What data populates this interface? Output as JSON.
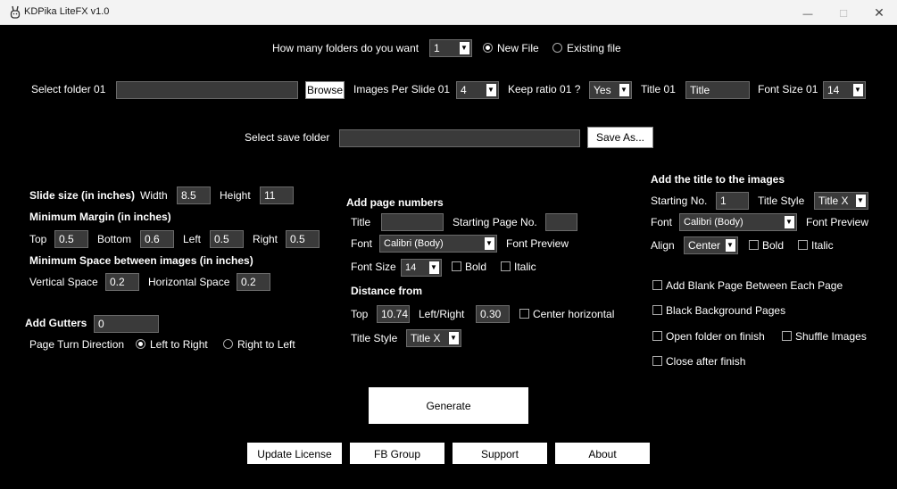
{
  "window": {
    "title": "KDPika LiteFX v1.0",
    "minimize_glyph": "—",
    "maximize_glyph": "☐",
    "close_glyph": "✕"
  },
  "top": {
    "folders_label": "How many folders do you want",
    "folders_value": "1",
    "new_file_label": "New File",
    "existing_file_label": "Existing file",
    "mode_selected": "New File"
  },
  "folder_row": {
    "select_label": "Select folder 01",
    "folder_value": "",
    "browse_label": "Browse",
    "images_per_slide_label": "Images Per Slide 01",
    "images_per_slide_value": "4",
    "keep_ratio_label": "Keep ratio 01 ?",
    "keep_ratio_value": "Yes",
    "title_label": "Title 01",
    "title_value": "Title",
    "font_size_label": "Font Size 01",
    "font_size_value": "14"
  },
  "save_row": {
    "select_label": "Select save folder",
    "folder_value": "",
    "save_as_label": "Save As..."
  },
  "slide": {
    "slide_size_label": "Slide size (in inches)",
    "width_label": "Width",
    "width_value": "8.5",
    "height_label": "Height",
    "height_value": "11",
    "min_margin_label": "Minimum Margin (in inches)",
    "top_label": "Top",
    "top_value": "0.5",
    "bottom_label": "Bottom",
    "bottom_value": "0.6",
    "left_label": "Left",
    "left_value": "0.5",
    "right_label": "Right",
    "right_value": "0.5",
    "min_space_label": "Minimum Space between images (in inches)",
    "vertical_label": "Vertical Space",
    "vertical_value": "0.2",
    "horizontal_label": "Horizontal Space",
    "horizontal_value": "0.2",
    "gutters_label": "Add Gutters",
    "gutters_value": "0",
    "page_turn_label": "Page Turn Direction",
    "ltr_label": "Left to Right",
    "rtl_label": "Right to Left"
  },
  "page_numbers": {
    "heading": "Add page numbers",
    "title_label": "Title",
    "title_value": "",
    "starting_label": "Starting Page No.",
    "starting_value": "",
    "font_label": "Font",
    "font_value": "Calibri (Body)",
    "font_preview_label": "Font Preview",
    "font_size_label": "Font Size",
    "font_size_value": "14",
    "bold_label": "Bold",
    "italic_label": "Italic",
    "distance_heading": "Distance from",
    "top_label": "Top",
    "top_value": "10.74",
    "lr_label": "Left/Right",
    "lr_value": "0.30",
    "center_label": "Center horizontal",
    "title_style_label": "Title Style",
    "title_style_value": "Title X"
  },
  "title_images": {
    "heading": "Add the title to the images",
    "starting_label": "Starting No.",
    "starting_value": "1",
    "title_style_label": "Title Style",
    "title_style_value": "Title X",
    "font_label": "Font",
    "font_value": "Calibri (Body)",
    "font_preview_label": "Font Preview",
    "align_label": "Align",
    "align_value": "Center",
    "bold_label": "Bold",
    "italic_label": "Italic"
  },
  "options": {
    "blank_page_label": "Add Blank Page Between Each Page",
    "black_bg_label": "Black Background Pages",
    "open_folder_label": "Open folder on finish",
    "shuffle_label": "Shuffle Images",
    "close_after_label": "Close after finish"
  },
  "actions": {
    "generate_label": "Generate",
    "update_license_label": "Update License",
    "fb_group_label": "FB Group",
    "support_label": "Support",
    "about_label": "About"
  }
}
